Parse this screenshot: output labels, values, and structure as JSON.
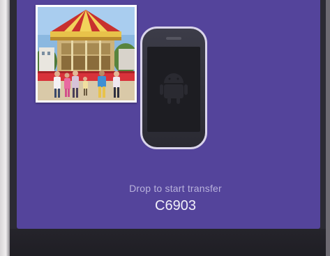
{
  "drop_panel": {
    "instruction": "Drop to start transfer",
    "device_name": "C6903"
  },
  "icons": {
    "phone": "smartphone-icon",
    "android": "android-icon",
    "photo": "photo-thumbnail"
  },
  "colors": {
    "panel_bg": "#54449b",
    "instruction_text": "#b9b2dc",
    "device_text": "#f2f0fa"
  }
}
